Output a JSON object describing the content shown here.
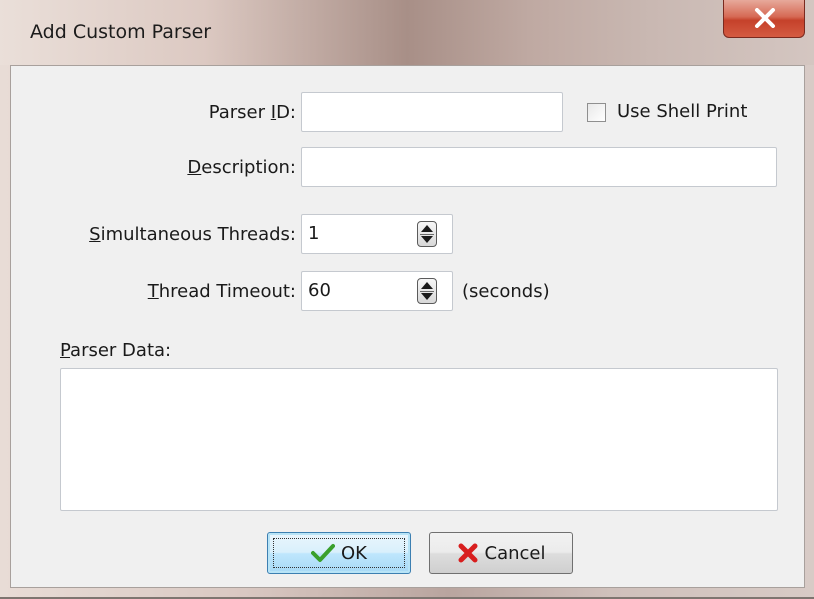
{
  "window": {
    "title": "Add Custom Parser"
  },
  "form": {
    "parser_id": {
      "label_pre": "Parser ",
      "label_key": "I",
      "label_post": "D:",
      "value": ""
    },
    "use_shell_print": {
      "label": "Use Shell Print",
      "checked": false
    },
    "description": {
      "label_pre": "",
      "label_key": "D",
      "label_post": "escription:",
      "value": ""
    },
    "simultaneous_threads": {
      "label_pre": "",
      "label_key": "S",
      "label_post": "imultaneous Threads:",
      "value": "1"
    },
    "thread_timeout": {
      "label_pre": "",
      "label_key": "T",
      "label_post": "hread Timeout:",
      "value": "60",
      "unit": "(seconds)"
    },
    "parser_data": {
      "label_pre": "",
      "label_key": "P",
      "label_post": "arser Data:",
      "value": ""
    }
  },
  "buttons": {
    "ok": "OK",
    "cancel": "Cancel"
  },
  "icons": {
    "ok": "checkmark-icon",
    "cancel": "red-x-icon",
    "close": "close-icon",
    "spinner": "spinner-icon"
  },
  "colors": {
    "close_button": "#c5412a",
    "ok_check": "#3aa02c",
    "cancel_x": "#d81e1e"
  }
}
